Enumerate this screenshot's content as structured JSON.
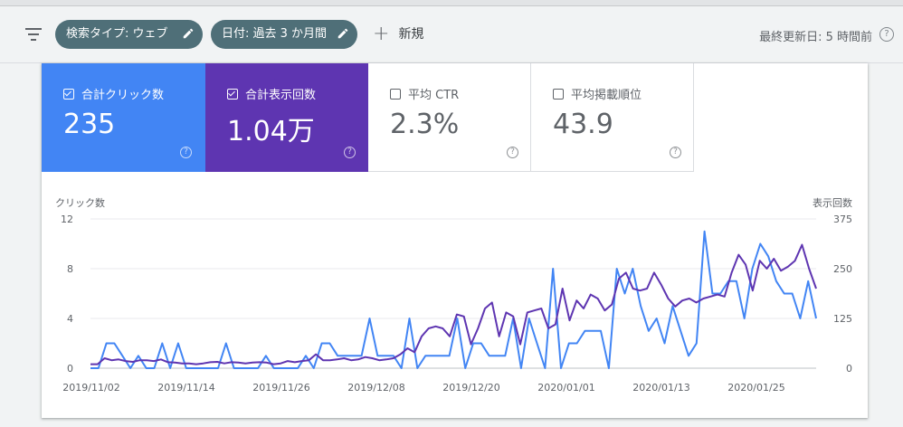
{
  "filters": {
    "search_type_chip": "検索タイプ: ウェブ",
    "date_chip": "日付: 過去 3 か月間",
    "new_label": "新規",
    "last_updated": "最終更新日: 5 時間前"
  },
  "metrics": [
    {
      "label": "合計クリック数",
      "value": "235",
      "checked": true,
      "color": "#4285f4"
    },
    {
      "label": "合計表示回数",
      "value": "1.04万",
      "checked": true,
      "color": "#5e35b1"
    },
    {
      "label": "平均 CTR",
      "value": "2.3%",
      "checked": false
    },
    {
      "label": "平均掲載順位",
      "value": "43.9",
      "checked": false
    }
  ],
  "chart_data": {
    "type": "line",
    "ylabel_left": "クリック数",
    "ylabel_right": "表示回数",
    "y_left_ticks": [
      "0",
      "4",
      "8",
      "12"
    ],
    "y_left_lim": [
      0,
      12
    ],
    "y_right_ticks": [
      "0",
      "125",
      "250",
      "375"
    ],
    "y_right_lim": [
      0,
      375
    ],
    "x_tick_labels": [
      "2019/11/02",
      "2019/11/14",
      "2019/11/26",
      "2019/12/08",
      "2019/12/20",
      "2020/01/01",
      "2020/01/13",
      "2020/01/25"
    ],
    "grid": true,
    "series": [
      {
        "name": "合計クリック数",
        "axis": "left",
        "color": "#4285f4",
        "values": [
          0,
          0,
          2,
          2,
          1,
          0,
          1,
          0,
          0,
          2,
          0,
          2,
          0,
          0,
          0,
          0,
          0,
          2,
          0,
          0,
          0,
          0,
          1,
          0,
          0,
          0,
          0,
          1,
          0,
          2,
          2,
          1,
          1,
          1,
          1,
          4,
          1,
          1,
          1,
          0,
          4,
          0,
          1,
          1,
          1,
          1,
          4,
          0,
          2,
          2,
          1,
          1,
          1,
          4,
          0,
          4,
          2,
          0,
          8,
          0,
          2,
          2,
          3,
          3,
          3,
          0,
          8,
          6,
          8,
          5,
          3,
          4,
          2,
          5,
          3,
          1,
          2,
          11,
          6,
          6,
          7,
          7,
          4,
          8,
          10,
          9,
          7,
          6,
          6,
          4,
          7,
          4
        ]
      },
      {
        "name": "合計表示回数",
        "axis": "right",
        "color": "#5e35b1",
        "values": [
          10,
          10,
          25,
          20,
          22,
          18,
          16,
          20,
          20,
          18,
          22,
          15,
          14,
          12,
          12,
          10,
          12,
          15,
          16,
          12,
          15,
          14,
          12,
          14,
          15,
          14,
          10,
          12,
          18,
          15,
          18,
          20,
          35,
          20,
          20,
          22,
          25,
          20,
          22,
          28,
          25,
          20,
          22,
          25,
          35,
          50,
          40,
          80,
          100,
          105,
          100,
          80,
          135,
          130,
          60,
          100,
          150,
          165,
          80,
          140,
          130,
          60,
          140,
          145,
          150,
          100,
          110,
          200,
          120,
          170,
          150,
          185,
          175,
          145,
          160,
          225,
          240,
          200,
          195,
          200,
          240,
          210,
          175,
          155,
          170,
          175,
          165,
          175,
          180,
          185,
          180,
          240,
          285,
          260,
          195,
          270,
          250,
          275,
          245,
          255,
          270,
          310,
          250,
          200
        ]
      }
    ]
  }
}
